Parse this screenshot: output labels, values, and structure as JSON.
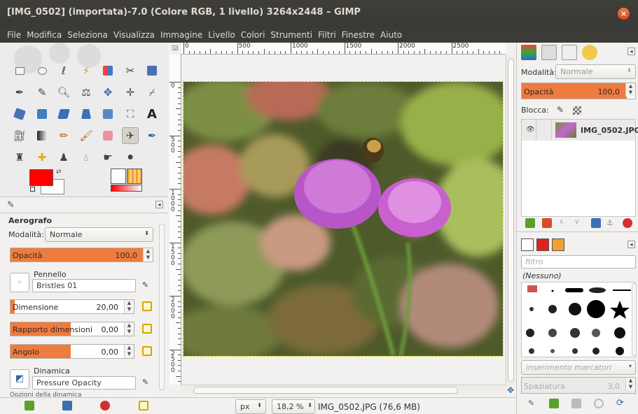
{
  "window": {
    "title": "[IMG_0502] (importata)-7.0 (Colore RGB, 1 livello) 3264x2448 – GIMP",
    "close_glyph": "×"
  },
  "menus": [
    "File",
    "Modifica",
    "Seleziona",
    "Visualizza",
    "Immagine",
    "Livello",
    "Colori",
    "Strumenti",
    "Filtri",
    "Finestre",
    "Aiuto"
  ],
  "tool_options": {
    "tool_name": "Aerografo",
    "mode_label": "Modalità:",
    "mode_value": "Normale",
    "opacity_label": "Opacità",
    "opacity_value": "100,0",
    "opacity_fraction": 1.0,
    "brush_label": "Pennello",
    "brush_value": "Bristles 01",
    "size_label": "Dimensione",
    "size_value": "20,00",
    "ratio_label": "Rapporto dimensioni",
    "ratio_value": "0,00",
    "angle_label": "Angolo",
    "angle_value": "0,00",
    "dynamics_label": "Dinamica",
    "dynamics_value": "Pressure Opacity",
    "options_label": "Opzioni della dinamica"
  },
  "colors": {
    "foreground": "#ff0000",
    "background": "#ffffff",
    "accent": "#ef7b3e"
  },
  "rulers": {
    "horizontal": [
      "0",
      "500",
      "1000",
      "1500",
      "2000",
      "2500"
    ],
    "vertical": [
      "0",
      "500",
      "1000",
      "1500",
      "2000",
      "2500"
    ]
  },
  "status": {
    "unit": "px",
    "zoom": "18,2 %",
    "file": "IMG_0502.JPG (76,6 MB)"
  },
  "layers": {
    "mode_label": "Modalità:",
    "mode_value": "Normale",
    "opacity_label": "Opacità",
    "opacity_value": "100,0",
    "lock_label": "Blocca:",
    "items": [
      {
        "name": "IMG_0502.JPG",
        "visible": true
      }
    ]
  },
  "brushes": {
    "filter_placeholder": "filtro",
    "tag_selected": "(Nessuno)",
    "tag_entry_placeholder": "inserimento marcatori",
    "spacing_label": "Spaziatura",
    "spacing_value": "3,0"
  }
}
